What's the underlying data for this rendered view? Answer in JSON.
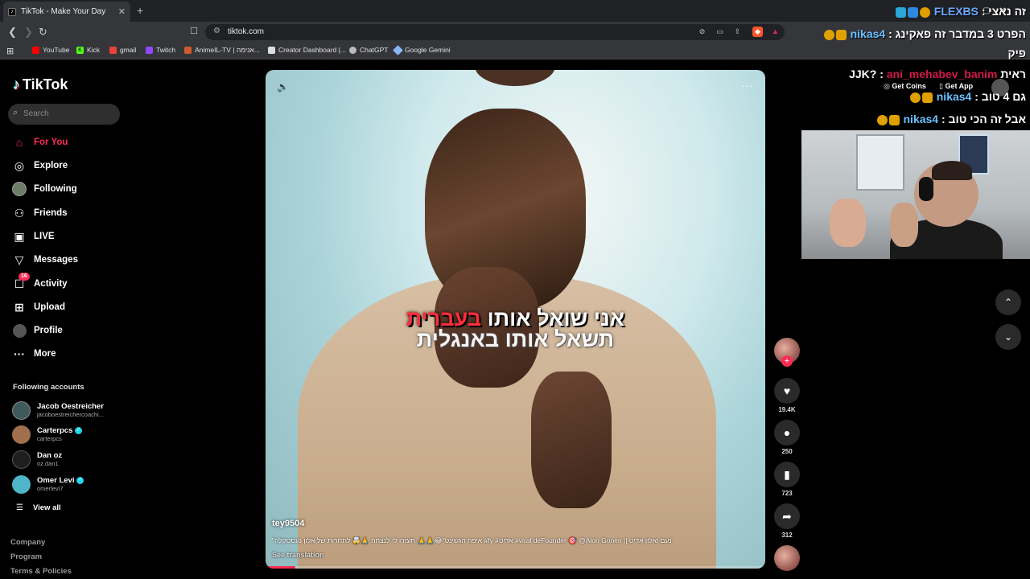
{
  "browser": {
    "tab_title": "TikTok - Make Your Day",
    "url": "tiktok.com",
    "bookmarks": [
      {
        "label": "YouTube",
        "color": "#ff0000"
      },
      {
        "label": "Kick",
        "color": "#53fc18"
      },
      {
        "label": "gmail",
        "color": "#ea4335"
      },
      {
        "label": "Twitch",
        "color": "#9146ff"
      },
      {
        "label": "AnimeIL-TV | אנימה...",
        "color": "#d05a2a"
      },
      {
        "label": "Creator Dashboard |...",
        "color": "#dddddd"
      },
      {
        "label": "ChatGPT",
        "color": "#bbbbbb"
      },
      {
        "label": "Google Gemini",
        "color": "#8ab4f8"
      }
    ]
  },
  "tiktok": {
    "logo": "TikTok",
    "search_placeholder": "Search",
    "nav": [
      {
        "label": "For You",
        "icon": "home-icon"
      },
      {
        "label": "Explore",
        "icon": "compass-icon"
      },
      {
        "label": "Following",
        "icon": "avatar-icon"
      },
      {
        "label": "Friends",
        "icon": "friends-icon"
      },
      {
        "label": "LIVE",
        "icon": "live-icon"
      },
      {
        "label": "Messages",
        "icon": "send-icon"
      },
      {
        "label": "Activity",
        "icon": "activity-icon",
        "badge": "16"
      },
      {
        "label": "Upload",
        "icon": "plus-square-icon"
      },
      {
        "label": "Profile",
        "icon": "profile-icon"
      },
      {
        "label": "More",
        "icon": "more-icon"
      }
    ],
    "following_title": "Following accounts",
    "accounts": [
      {
        "name": "Jacob Oestreicher",
        "handle": "jacoboestreichercoachi...",
        "verified": false
      },
      {
        "name": "Carterpcs",
        "handle": "carterpcs",
        "verified": true
      },
      {
        "name": "Dan oz",
        "handle": "oz.dan1",
        "verified": false
      },
      {
        "name": "Omer Levi",
        "handle": "omerlevi7",
        "verified": true
      }
    ],
    "view_all": "View all",
    "footer": [
      "Company",
      "Program",
      "Terms & Policies"
    ],
    "get_coins": "Get Coins",
    "get_app": "Get App"
  },
  "video": {
    "subtitle_line1_white": "אני שואל אותו ",
    "subtitle_line1_red": "בעברית",
    "subtitle_line2": "תשאל אותו באנגלית",
    "username": "tey9504",
    "caption": "\"איפה הגשינט\"😂🙏🙏 תעזרו לי לנצחה 🙏🤯 לתחרות של אלון נעסטקלה #fy #אדיט #viral deFounder 🎯 @Alon Gonen || נעם ואלון אדיט",
    "see_translation": "See translation",
    "progress": 0.06,
    "likes": "19.4K",
    "comments": "250",
    "saves": "723",
    "shares": "312"
  },
  "chat": {
    "lines": [
      {
        "user": "FLEXBS",
        "text": "זה נאצי"
      },
      {
        "user": "nikas4",
        "text": "הפרט 3 במדבר זה פאקינג"
      },
      {
        "user": "",
        "text": "פיק"
      },
      {
        "user": "ani_mehabev_banim",
        "text": "ראית JJK?"
      },
      {
        "user": "nikas4",
        "text": "גם 4 טוב"
      },
      {
        "user": "nikas4",
        "text": "אבל זה הכי טוב"
      }
    ]
  }
}
